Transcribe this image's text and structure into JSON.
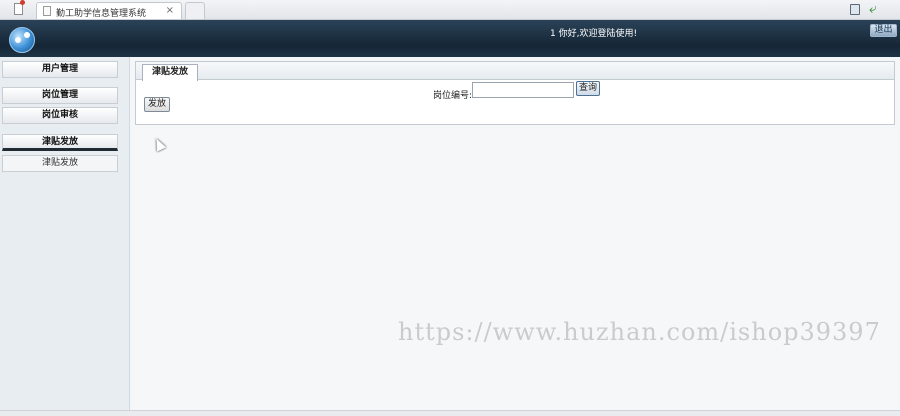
{
  "browser": {
    "tab_title": "勤工助学信息管理系统",
    "tab_close": "×"
  },
  "header": {
    "welcome": "1 你好,欢迎登陆使用!",
    "logout_label": "退出"
  },
  "sidebar": {
    "items": [
      {
        "label": "用户管理"
      },
      {
        "label": "岗位管理"
      },
      {
        "label": "岗位审核"
      },
      {
        "label": "津贴发放"
      }
    ],
    "sub_items": [
      {
        "label": "津贴发放"
      }
    ]
  },
  "main": {
    "tab_label": "津贴发放",
    "search_label": "岗位编号:",
    "search_value": "",
    "query_label": "查询",
    "issue_label": "发放"
  },
  "watermark": "https://www.huzhan.com/ishop39397"
}
